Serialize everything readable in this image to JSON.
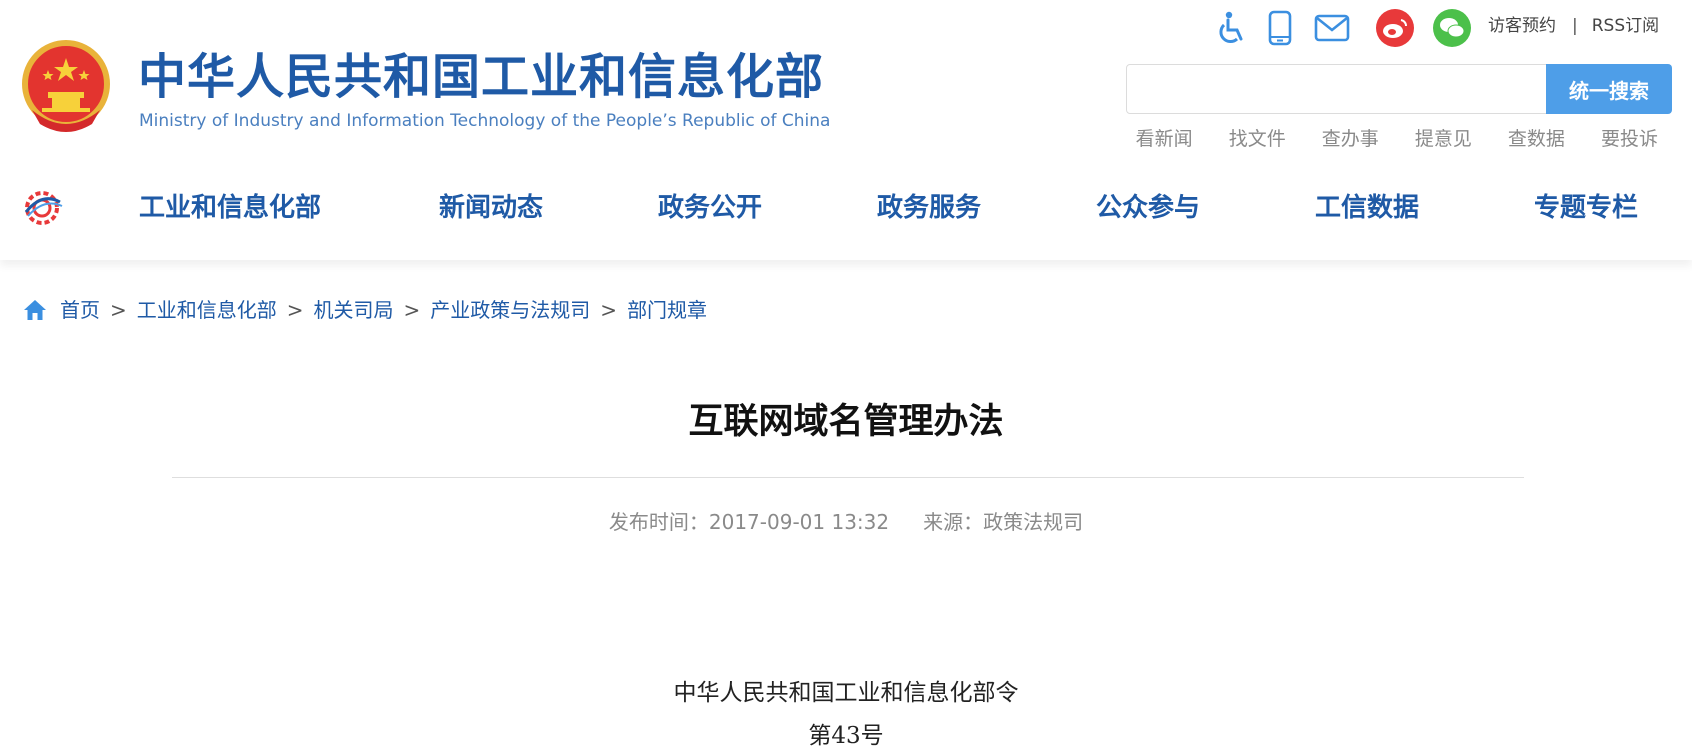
{
  "header": {
    "site_name_cn": "中华人民共和国工业和信息化部",
    "site_name_en": "Ministry of Industry and Information Technology of the People’s Republic of China",
    "top_icons": [
      "accessibility-icon",
      "mobile-icon",
      "mail-icon",
      "weibo-icon",
      "wechat-icon"
    ],
    "visitor_booking": "访客预约",
    "separator": "|",
    "rss": "RSS订阅",
    "search": {
      "placeholder": "",
      "button": "统一搜索"
    },
    "quick_links": [
      "看新闻",
      "找文件",
      "查办事",
      "提意见",
      "查数据",
      "要投诉"
    ]
  },
  "nav": {
    "items": [
      "工业和信息化部",
      "新闻动态",
      "政务公开",
      "政务服务",
      "公众参与",
      "工信数据",
      "专题专栏"
    ]
  },
  "breadcrumb": {
    "items": [
      "首页",
      "工业和信息化部",
      "机关司局",
      "产业政策与法规司",
      "部门规章"
    ],
    "separator": ">"
  },
  "article": {
    "title": "互联网域名管理办法",
    "publish_label": "发布时间：",
    "publish_time": "2017-09-01 13:32",
    "source_label": "来源：",
    "source": "政策法规司",
    "body_line1": "中华人民共和国工业和信息化部令",
    "body_line2": "第43号"
  },
  "colors": {
    "brand_blue": "#1f5aa6",
    "search_button": "#4e9ee8",
    "accent_red": "#e8393a",
    "wechat_green": "#4cc04a"
  }
}
